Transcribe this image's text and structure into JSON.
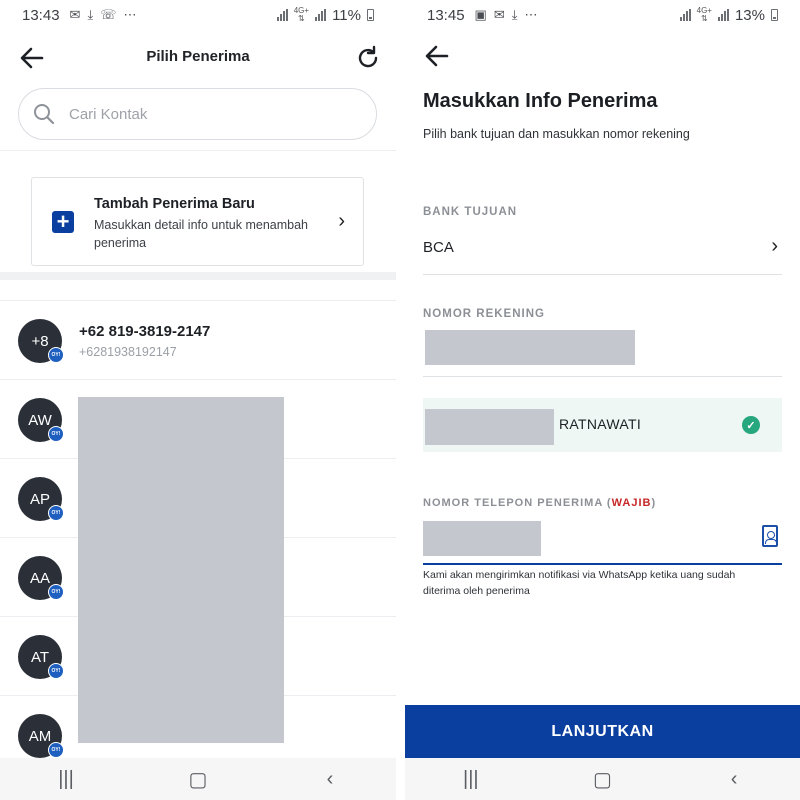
{
  "left": {
    "status": {
      "time": "13:43",
      "icons": [
        "mail-icon",
        "download-icon",
        "missed-call-icon",
        "more-icon"
      ],
      "battery": "11%"
    },
    "header": {
      "title": "Pilih Penerima",
      "back_icon": "back-arrow-icon",
      "refresh_icon": "refresh-icon"
    },
    "search": {
      "placeholder": "Cari Kontak"
    },
    "add_card": {
      "title": "Tambah Penerima Baru",
      "subtitle": "Masukkan detail info untuk menambah penerima"
    },
    "contacts": [
      {
        "initials": "+8",
        "name": "+62 819-3819-2147",
        "sub": "+6281938192147",
        "badge": "OY!"
      },
      {
        "initials": "AW",
        "badge": "OY!"
      },
      {
        "initials": "AP",
        "badge": "OY!"
      },
      {
        "initials": "AA",
        "badge": "OY!"
      },
      {
        "initials": "AT",
        "badge": "OY!"
      },
      {
        "initials": "AM",
        "badge": "OY!"
      }
    ]
  },
  "right": {
    "status": {
      "time": "13:45",
      "icons": [
        "image-icon",
        "mail-icon",
        "download-icon",
        "more-icon"
      ],
      "battery": "13%"
    },
    "title": "Masukkan Info Penerima",
    "subtitle": "Pilih bank tujuan dan masukkan nomor rekening",
    "bank_label": "BANK TUJUAN",
    "bank_value": "BCA",
    "account_label": "NOMOR REKENING",
    "verified_name": "RATNAWATI",
    "phone_label": "NOMOR TELEPON PENERIMA (",
    "phone_required": "WAJIB",
    "phone_label_end": ")",
    "note": "Kami akan mengirimkan notifikasi via WhatsApp ketika uang sudah diterima oleh penerima",
    "cta": "LANJUTKAN"
  },
  "colors": {
    "brand": "#0b3f9f",
    "success": "#27a77d",
    "required": "#c62828"
  }
}
